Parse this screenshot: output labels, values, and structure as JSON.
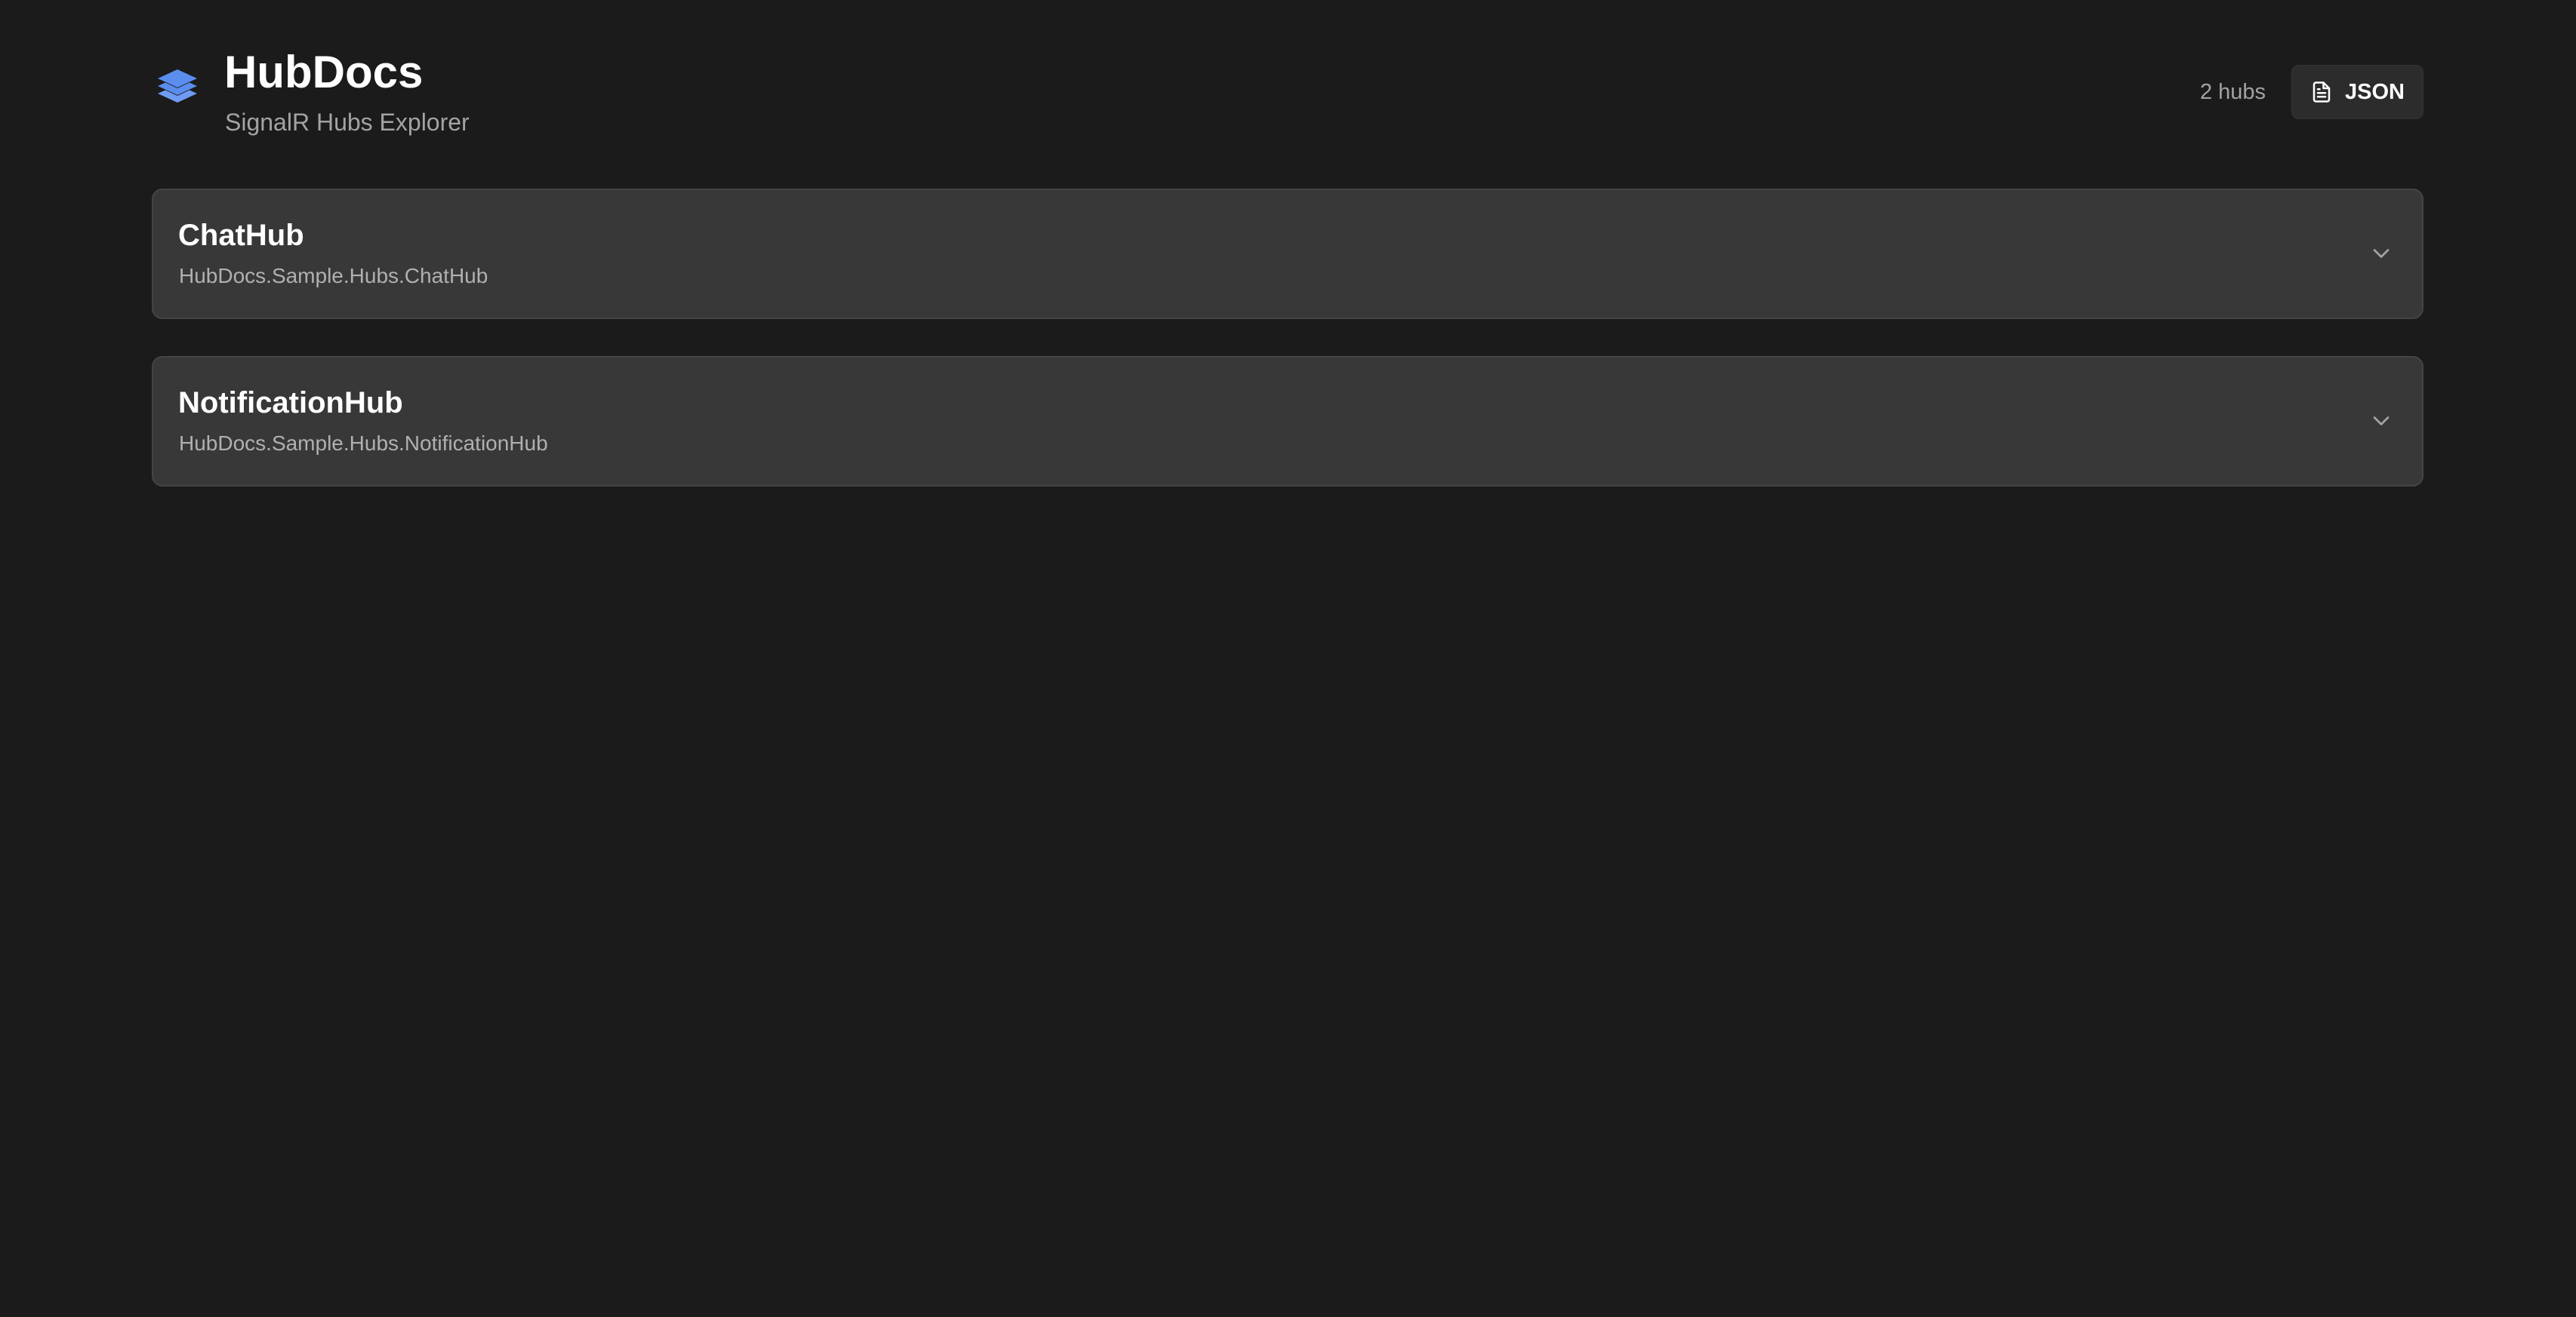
{
  "header": {
    "title": "HubDocs",
    "subtitle": "SignalR Hubs Explorer",
    "hub_count": "2 hubs",
    "json_button_label": "JSON",
    "logo_icon": "layers-icon",
    "accent_color": "#5b8def"
  },
  "hubs": [
    {
      "name": "ChatHub",
      "full_name": "HubDocs.Sample.Hubs.ChatHub",
      "expand_icon": "chevron-down-icon"
    },
    {
      "name": "NotificationHub",
      "full_name": "HubDocs.Sample.Hubs.NotificationHub",
      "expand_icon": "chevron-down-icon"
    }
  ]
}
